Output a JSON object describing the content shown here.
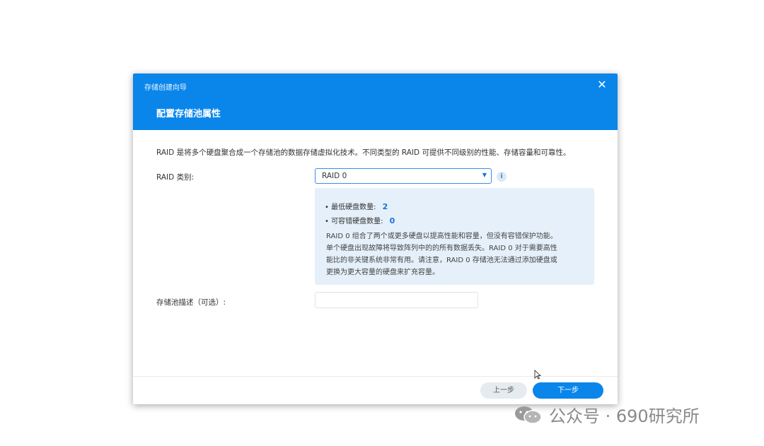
{
  "dialog": {
    "wizard_title": "存储创建向导",
    "close_glyph": "✕",
    "step_title": "配置存储池属性",
    "intro": "RAID 是将多个硬盘聚合成一个存储池的数据存储虚拟化技术。不同类型的 RAID 可提供不同级别的性能、存储容量和可靠性。",
    "raid": {
      "label": "RAID 类别:",
      "selected": "RAID 0",
      "info_glyph": "i"
    },
    "info_box": {
      "min_disks_label": "最低硬盘数量:",
      "min_disks_value": "2",
      "fault_tolerance_label": "可容错硬盘数量:",
      "fault_tolerance_value": "0",
      "description_lines": [
        "RAID 0 组合了两个或更多硬盘以提高性能和容量，但没有容错保护功能。",
        "单个硬盘出现故障将导致阵列中的的所有数据丢失。RAID 0 对于需要高性",
        "能比的非关键系统非常有用。请注意，RAID 0 存储池无法通过添加硬盘或",
        "更换为更大容量的硬盘来扩充容量。"
      ]
    },
    "pool_description": {
      "label": "存储池描述（可选）:",
      "value": ""
    },
    "footer": {
      "back_label": "上一步",
      "next_label": "下一步"
    }
  },
  "watermark": {
    "text": "公众号 · 690研究所"
  },
  "colors": {
    "accent": "#0a86ea",
    "info_bg": "#e5f0fa",
    "highlight_number": "#1a73d6"
  }
}
